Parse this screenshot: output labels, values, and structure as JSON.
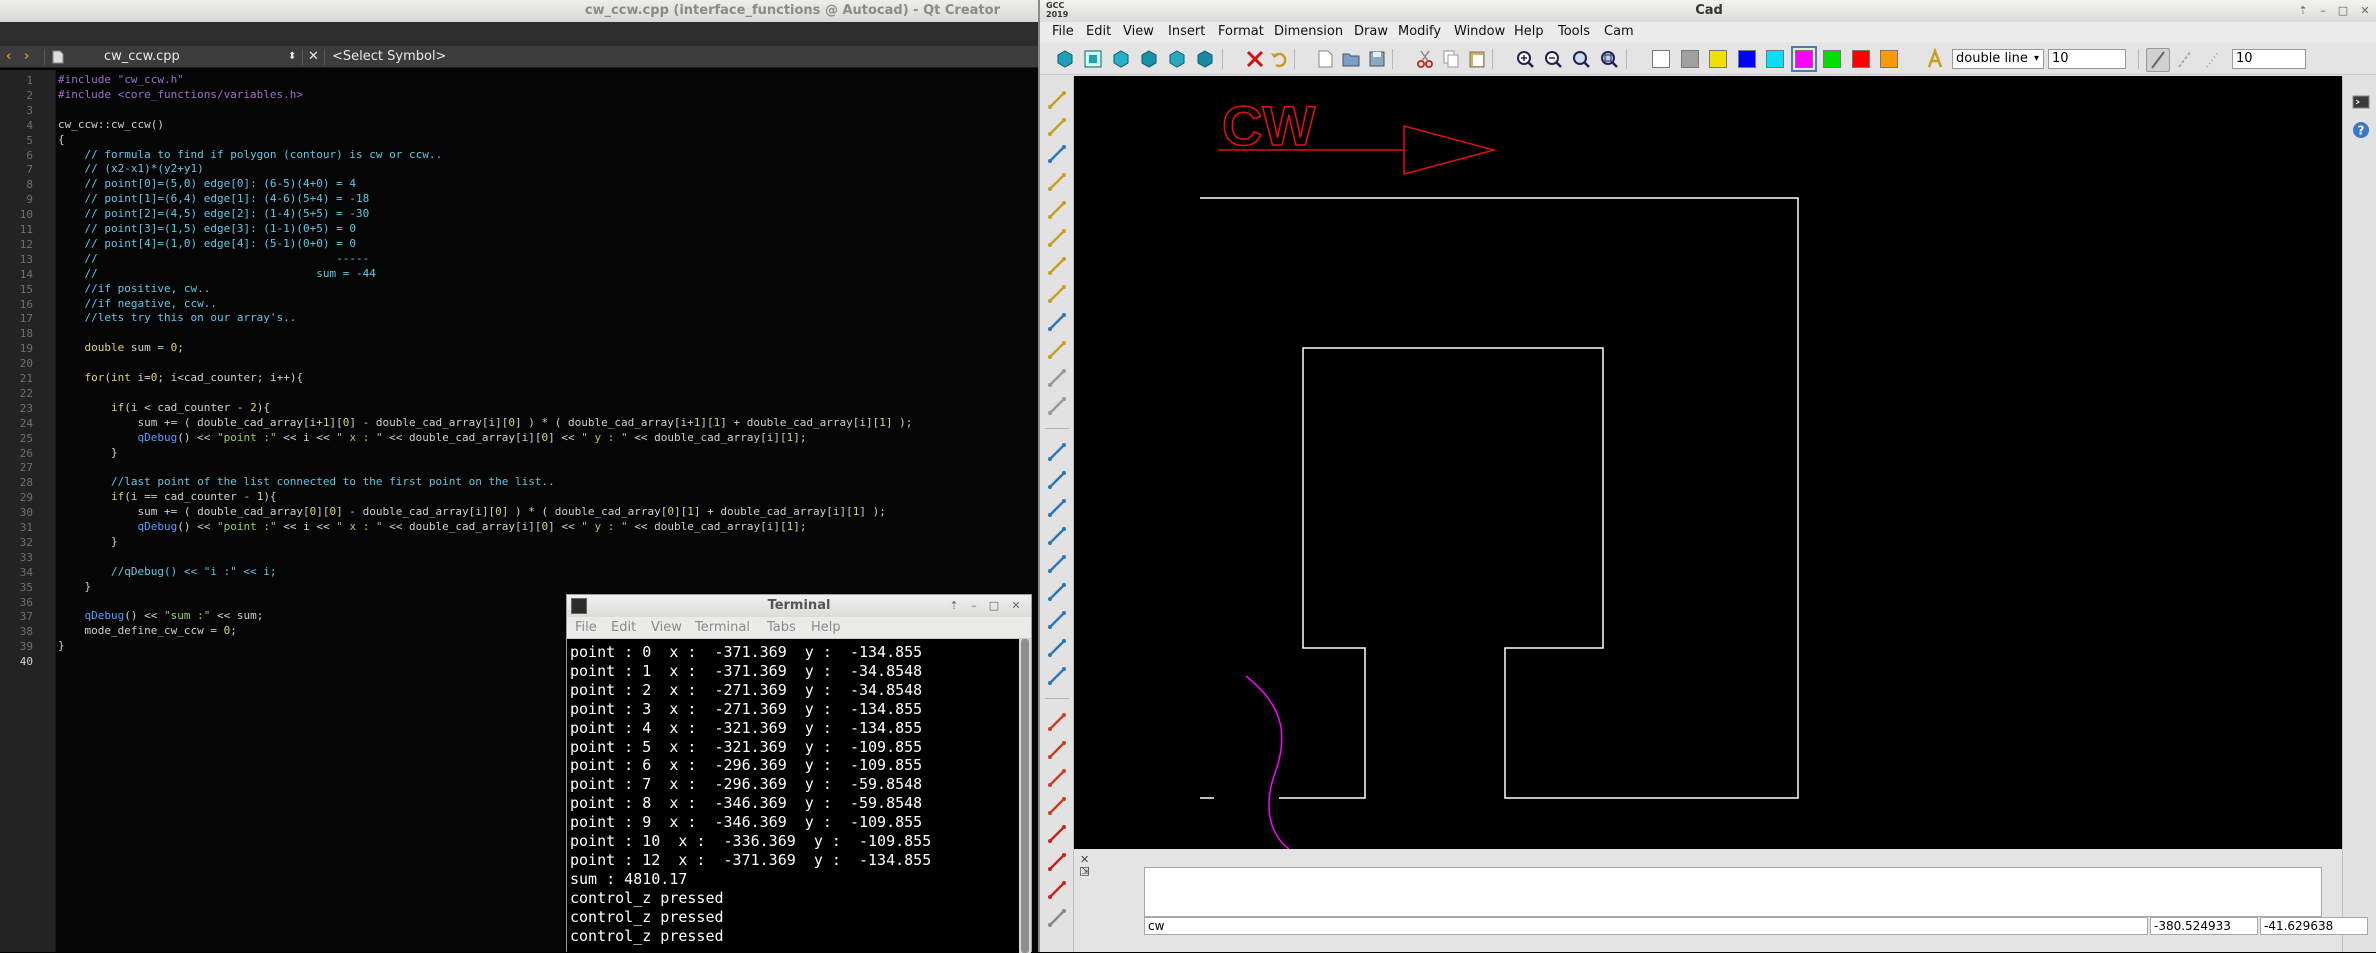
{
  "qt": {
    "title": "cw_ccw.cpp (interface_functions @ Autocad) - Qt Creator",
    "file_tab": "cw_ccw.cpp",
    "symbol_selector": "<Select Symbol>",
    "line_count": 40
  },
  "code": [
    "#include \"cw_ccw.h\"",
    "#include <core_functions/variables.h>",
    "",
    "cw_ccw::cw_ccw()",
    "{",
    "    // formula to find if polygon (contour) is cw or ccw..",
    "    // (x2-x1)*(y2+y1)",
    "    // point[0]=(5,0) edge[0]: (6-5)(4+0) = 4",
    "    // point[1]=(6,4) edge[1]: (4-6)(5+4) = -18",
    "    // point[2]=(4,5) edge[2]: (1-4)(5+5) = -30",
    "    // point[3]=(1,5) edge[3]: (1-1)(0+5) = 0",
    "    // point[4]=(1,0) edge[4]: (5-1)(0+0) = 0",
    "    //                                    -----",
    "    //                                 sum = -44",
    "    //if positive, cw..",
    "    //if negative, ccw..",
    "    //lets try this on our array's..",
    "",
    "    double sum = 0;",
    "",
    "    for(int i=0; i<cad_counter; i++){",
    "",
    "        if(i < cad_counter - 2){",
    "            sum += ( double_cad_array[i+1][0] - double_cad_array[i][0] ) * ( double_cad_array[i+1][1] + double_cad_array[i][1] );",
    "            qDebug() << \"point :\" << i << \" x : \" << double_cad_array[i][0] << \" y : \" << double_cad_array[i][1];",
    "        }",
    "",
    "        //last point of the list connected to the first point on the list..",
    "        if(i == cad_counter - 1){",
    "            sum += ( double_cad_array[0][0] - double_cad_array[i][0] ) * ( double_cad_array[0][1] + double_cad_array[i][1] );",
    "            qDebug() << \"point :\" << i << \" x : \" << double_cad_array[i][0] << \" y : \" << double_cad_array[i][1];",
    "        }",
    "",
    "        //qDebug() << \"i :\" << i;",
    "    }",
    "",
    "    qDebug() << \"sum :\" << sum;",
    "    mode_define_cw_ccw = 0;",
    "}",
    ""
  ],
  "terminal": {
    "title": "Terminal",
    "menu": [
      "File",
      "Edit",
      "View",
      "Terminal",
      "Tabs",
      "Help"
    ],
    "lines": [
      "point : 0  x :  -371.369  y :  -134.855",
      "point : 1  x :  -371.369  y :  -34.8548",
      "point : 2  x :  -271.369  y :  -34.8548",
      "point : 3  x :  -271.369  y :  -134.855",
      "point : 4  x :  -321.369  y :  -134.855",
      "point : 5  x :  -321.369  y :  -109.855",
      "point : 6  x :  -296.369  y :  -109.855",
      "point : 7  x :  -296.369  y :  -59.8548",
      "point : 8  x :  -346.369  y :  -59.8548",
      "point : 9  x :  -346.369  y :  -109.855",
      "point : 10  x :  -336.369  y :  -109.855",
      "point : 12  x :  -371.369  y :  -134.855",
      "sum : 4810.17",
      "control_z pressed",
      "control_z pressed",
      "control_z pressed"
    ]
  },
  "cad": {
    "title": "Cad",
    "menu": [
      "File",
      "Edit",
      "View",
      "Insert",
      "Format",
      "Dimension",
      "Draw",
      "Modify",
      "Window",
      "Help",
      "Tools",
      "Cam"
    ],
    "line_type": "double line",
    "line_width": "10",
    "line_width_2": "10",
    "canvas_label": "CW",
    "command_text": "cw",
    "coord_x": "-380.524933",
    "coord_y": "-41.629638",
    "colors": [
      "#ffffff",
      "#a0a0a0",
      "#f0e000",
      "#0000ff",
      "#00e0ff",
      "#ff00ff",
      "#00e000",
      "#ff0000",
      "#ff9a00"
    ],
    "selected_color": "#ff00ff",
    "logo_text": "GCC 2019"
  }
}
